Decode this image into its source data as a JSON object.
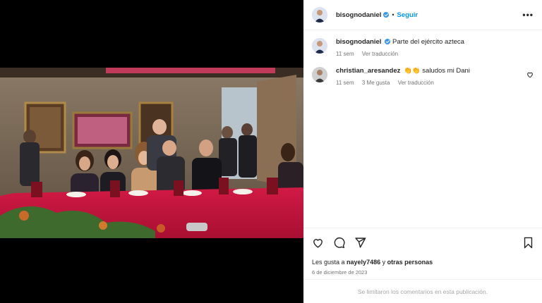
{
  "post": {
    "username": "bisognodaniel",
    "separator": "•",
    "follow_label": "Seguir",
    "more_label": "•••",
    "photo_alt": "Grupo de personas posando en una mesa de banquete con mantel rojo"
  },
  "comments": [
    {
      "username": "bisognodaniel",
      "text": "Parte del ejército azteca",
      "time": "11 sem",
      "likes": "",
      "translate": "Ver traducción"
    },
    {
      "username": "christian_aresandez",
      "text": "👏👏 saludos mi Dani",
      "time": "11 sem",
      "likes": "3 Me gusta",
      "translate": "Ver traducción"
    }
  ],
  "actions": {
    "likes_prefix": "Les gusta a ",
    "likes_user": "nayely7486",
    "likes_middle": " y ",
    "likes_others": "otras personas",
    "date": "6 de diciembre de 2023"
  },
  "footer": {
    "text": "Se limitaron los comentarios en esta publicación."
  },
  "colors": {
    "link": "#0095f6",
    "verified": "#3897f0",
    "tablecloth": "#c8163c"
  }
}
